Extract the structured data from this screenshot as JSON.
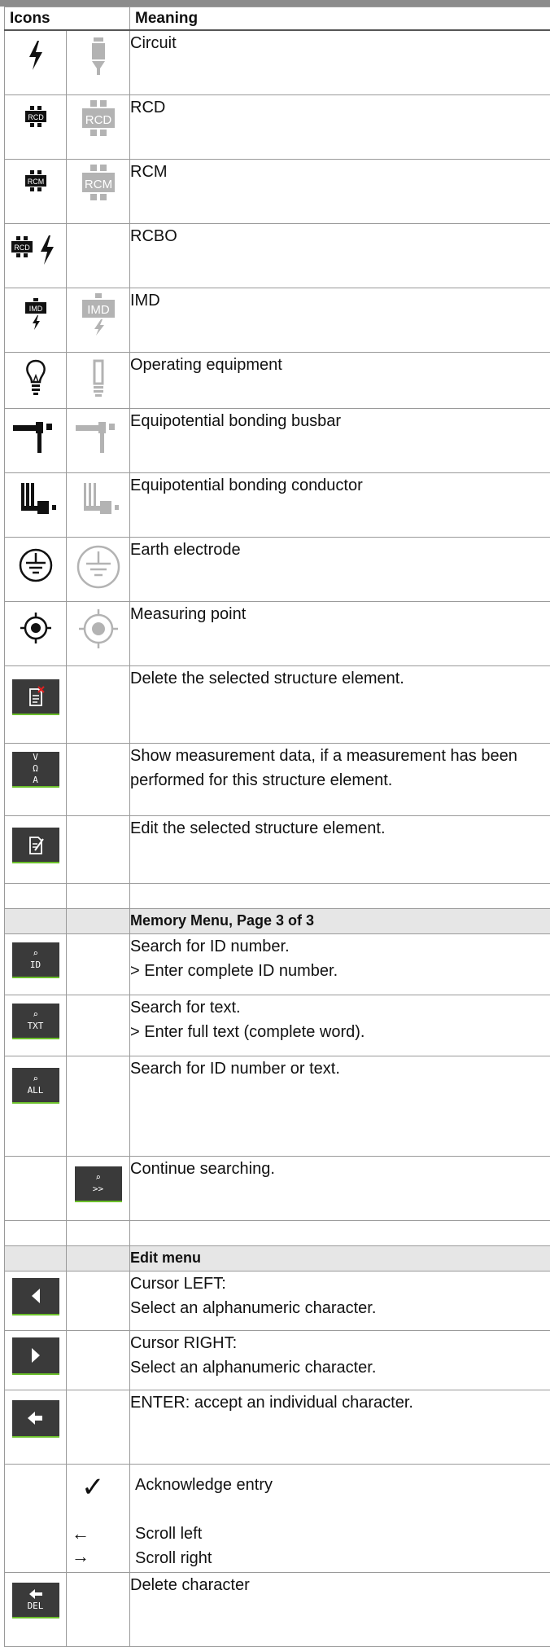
{
  "header": {
    "col_icons": "Icons",
    "col_meaning": "Meaning"
  },
  "rows": [
    {
      "icon": "circuit-icon",
      "meaning": "Circuit"
    },
    {
      "icon": "rcd-icon",
      "meaning": "RCD",
      "label": "RCD"
    },
    {
      "icon": "rcm-icon",
      "meaning": "RCM",
      "label": "RCM"
    },
    {
      "icon": "rcbo-icon",
      "meaning": "RCBO",
      "label": "RCD"
    },
    {
      "icon": "imd-icon",
      "meaning": "IMD",
      "label": "IMD"
    },
    {
      "icon": "operating-equipment-icon",
      "meaning": "Operating equipment"
    },
    {
      "icon": "busbar-icon",
      "meaning": "Equipotential bonding busbar"
    },
    {
      "icon": "bonding-conductor-icon",
      "meaning": "Equipotential bonding conductor"
    },
    {
      "icon": "earth-electrode-icon",
      "meaning": "Earth electrode"
    },
    {
      "icon": "measuring-point-icon",
      "meaning": "Measuring point"
    },
    {
      "icon": "delete-element-key-icon",
      "meaning": "Delete the selected structure element."
    },
    {
      "icon": "measurement-data-key-icon",
      "meaning": "Show measurement data, if a measurement has been performed for this structure element.",
      "key_lines": [
        "V",
        "Ω",
        "A"
      ]
    },
    {
      "icon": "edit-element-key-icon",
      "meaning": "Edit the selected structure element."
    }
  ],
  "memory_section": {
    "title": "Memory Menu, Page 3 of 3"
  },
  "memory_rows": [
    {
      "key_label": "ID",
      "line1": "Search for ID number.",
      "line2": "> Enter complete ID number."
    },
    {
      "key_label": "TXT",
      "line1": "Search for text.",
      "line2": "> Enter full text (complete word)."
    },
    {
      "key_label": "ALL",
      "line1": "Search for ID number or text.",
      "line2": ""
    },
    {
      "key_label": ">>",
      "line1": "Continue searching.",
      "line2": ""
    }
  ],
  "edit_section": {
    "title": "Edit menu"
  },
  "edit_rows": [
    {
      "line1": "Cursor LEFT:",
      "line2": "Select an alphanumeric character."
    },
    {
      "line1": "Cursor RIGHT:",
      "line2": "Select an alphanumeric character."
    },
    {
      "line1": "ENTER: accept an individual character.",
      "line2": ""
    }
  ],
  "acknowledge": {
    "check": "✓",
    "left": "←",
    "right": "→",
    "ack": "Acknowledge entry",
    "scroll_left": "Scroll left",
    "scroll_right": "Scroll right"
  },
  "delete_char": {
    "key_label": "DEL",
    "meaning": "Delete character"
  },
  "colors": {
    "key_bg": "#3a3a3a",
    "key_accent": "#6bbf2a",
    "section_bg": "#e6e6e6",
    "grey_icon": "#b3b3b3"
  }
}
